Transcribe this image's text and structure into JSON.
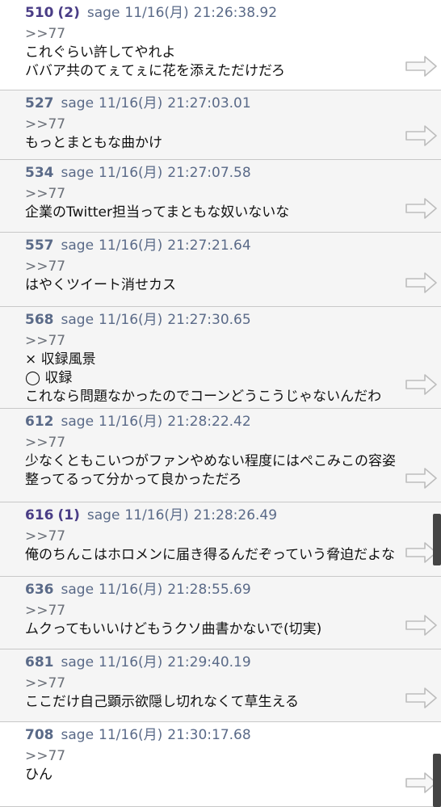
{
  "posts": [
    {
      "number": "510",
      "reply_count": "(2)",
      "name": "sage",
      "date": "11/16(月)",
      "time": "21:26:38.92",
      "anchor": ">>77",
      "lines": [
        "これぐらい許してやれよ",
        "ババア共のてぇてぇに花を添えただけだろ"
      ]
    },
    {
      "number": "527",
      "reply_count": "",
      "name": "sage",
      "date": "11/16(月)",
      "time": "21:27:03.01",
      "anchor": ">>77",
      "lines": [
        "もっとまともな曲かけ"
      ]
    },
    {
      "number": "534",
      "reply_count": "",
      "name": "sage",
      "date": "11/16(月)",
      "time": "21:27:07.58",
      "anchor": ">>77",
      "lines": [
        "企業のTwitter担当ってまともな奴いないな"
      ]
    },
    {
      "number": "557",
      "reply_count": "",
      "name": "sage",
      "date": "11/16(月)",
      "time": "21:27:21.64",
      "anchor": ">>77",
      "lines": [
        "はやくツイート消せカス"
      ]
    },
    {
      "number": "568",
      "reply_count": "",
      "name": "sage",
      "date": "11/16(月)",
      "time": "21:27:30.65",
      "anchor": ">>77",
      "lines": [
        "× 収録風景",
        "◯ 収録",
        "これなら問題なかったのでコーンどうこうじゃないんだわ"
      ]
    },
    {
      "number": "612",
      "reply_count": "",
      "name": "sage",
      "date": "11/16(月)",
      "time": "21:28:22.42",
      "anchor": ">>77",
      "lines": [
        "少なくともこいつがファンやめない程度にはぺこみこの容姿",
        "整ってるって分かって良かっただろ"
      ]
    },
    {
      "number": "616",
      "reply_count": "(1)",
      "name": "sage",
      "date": "11/16(月)",
      "time": "21:28:26.49",
      "anchor": ">>77",
      "lines": [
        "俺のちんこはホロメンに届き得るんだぞっていう脅迫だよな"
      ]
    },
    {
      "number": "636",
      "reply_count": "",
      "name": "sage",
      "date": "11/16(月)",
      "time": "21:28:55.69",
      "anchor": ">>77",
      "lines": [
        "ムクってもいいけどもうクソ曲書かないで(切実)"
      ]
    },
    {
      "number": "681",
      "reply_count": "",
      "name": "sage",
      "date": "11/16(月)",
      "time": "21:29:40.19",
      "anchor": ">>77",
      "lines": [
        "ここだけ自己顕示欲隠し切れなくて草生える"
      ]
    },
    {
      "number": "708",
      "reply_count": "",
      "name": "sage",
      "date": "11/16(月)",
      "time": "21:30:17.68",
      "anchor": ">>77",
      "lines": [
        "ひん"
      ]
    }
  ],
  "icons": {
    "reply_arrow": "right-arrow-icon"
  },
  "colors": {
    "post_number": "#5a6a88",
    "replied_number": "#4a3d86",
    "scrollbar": "#444444"
  }
}
